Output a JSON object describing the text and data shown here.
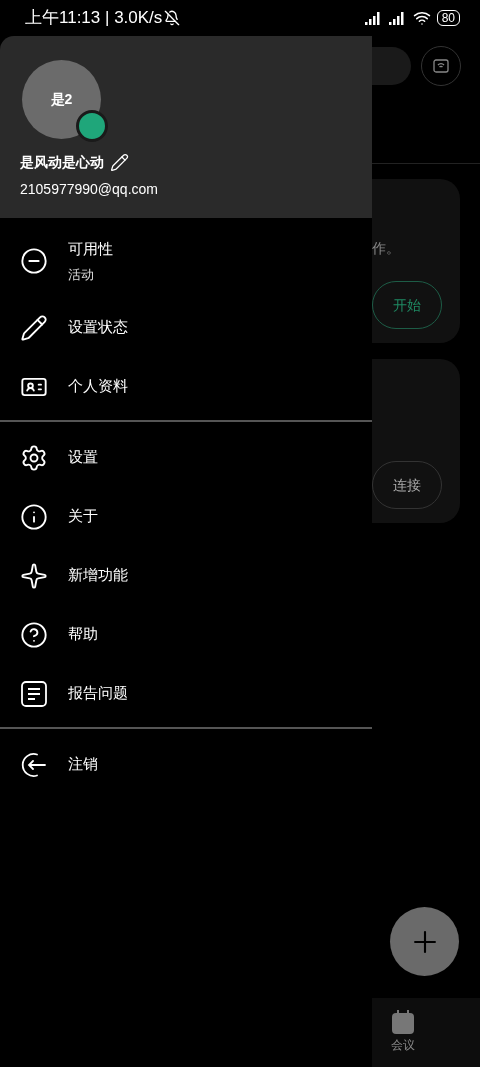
{
  "status_bar": {
    "time": "上午11:13 | 3.0K/s",
    "battery": "80"
  },
  "background": {
    "cards": [
      {
        "kind": "primary",
        "text": "作。",
        "button": "开始"
      },
      {
        "kind": "secondary",
        "button": "连接"
      }
    ],
    "bottom_nav": [
      {
        "label": "会议"
      }
    ]
  },
  "drawer": {
    "profile": {
      "avatar_text": "是2",
      "online": true,
      "name": "是风动是心动",
      "email": "2105977990@qq.com"
    },
    "sections": [
      [
        {
          "label": "可用性",
          "sublabel": "活动"
        },
        {
          "label": "设置状态"
        },
        {
          "label": "个人资料"
        }
      ],
      [
        {
          "label": "设置"
        },
        {
          "label": "关于"
        },
        {
          "label": "新增功能"
        },
        {
          "label": "帮助"
        },
        {
          "label": "报告问题"
        }
      ],
      [
        {
          "label": "注销"
        }
      ]
    ]
  }
}
